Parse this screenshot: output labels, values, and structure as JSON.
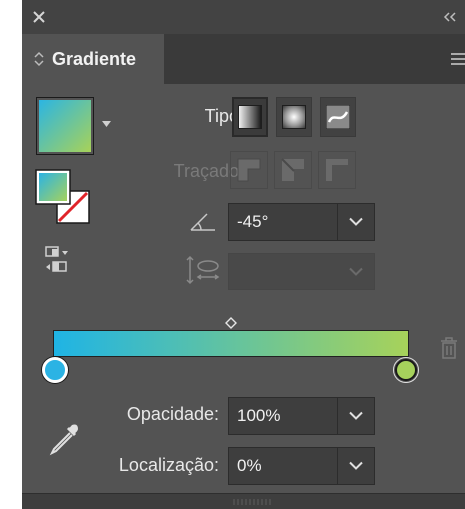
{
  "panel": {
    "title": "Gradiente",
    "icons": {
      "close": "close-icon",
      "collapse": "double-chevron-left-icon",
      "menu": "hamburger-menu-icon"
    }
  },
  "gradient": {
    "start_color": "#2bb3e4",
    "end_color": "#a6d25c",
    "type_label": "Tipo:",
    "types": [
      "linear",
      "radial",
      "freeform"
    ],
    "selected_type": "linear",
    "stroke_label": "Traçado:",
    "angle_value": "-45°",
    "aspect_value": "",
    "opacity_label": "Opacidade:",
    "opacity_value": "100%",
    "location_label": "Localização:",
    "location_value": "0%",
    "selected_stop": "left"
  },
  "colors": {
    "panel_bg": "#535353",
    "header_bg": "#3a3a3a",
    "field_bg": "#3e3e3e"
  }
}
